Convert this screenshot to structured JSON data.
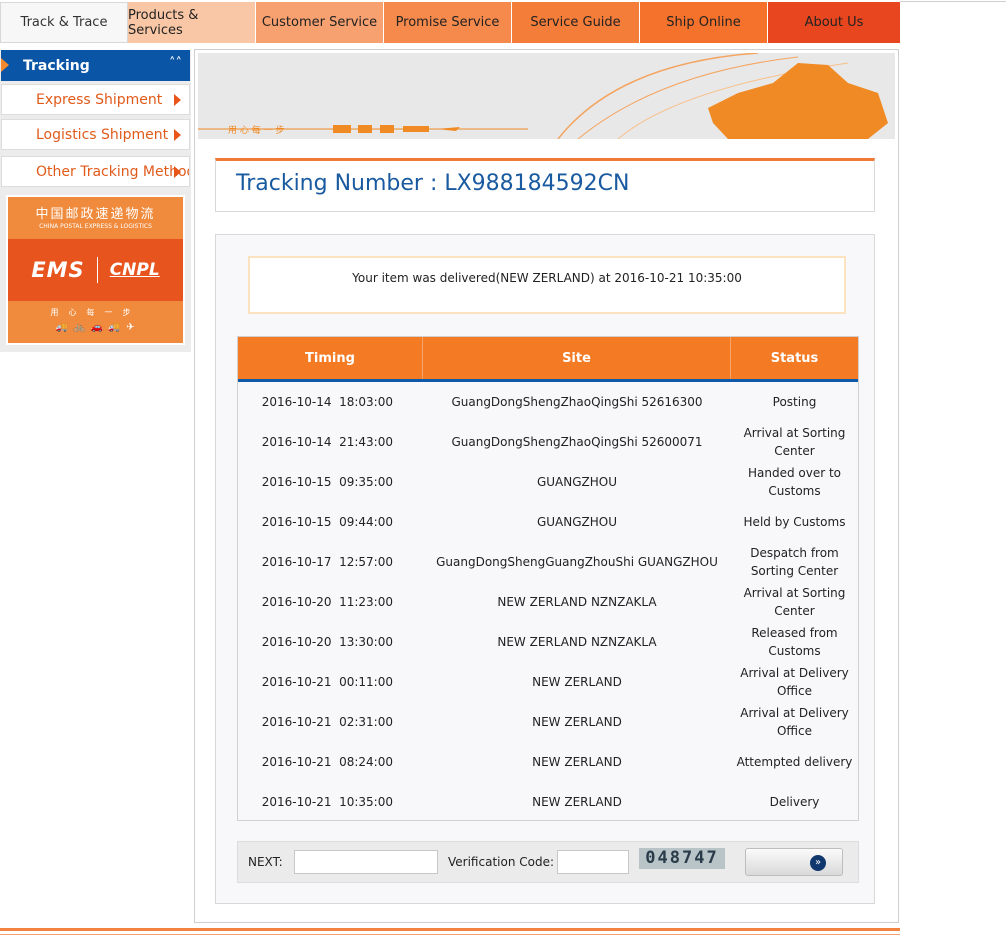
{
  "nav": {
    "items": [
      {
        "label": "Track & Trace"
      },
      {
        "label": "Products & Services"
      },
      {
        "label": "Customer Service"
      },
      {
        "label": "Promise Service"
      },
      {
        "label": "Service Guide"
      },
      {
        "label": "Ship Online"
      },
      {
        "label": "About Us"
      }
    ]
  },
  "sidebar": {
    "active": {
      "label": "Tracking",
      "icon": "double-chevron-up-icon"
    },
    "items": [
      {
        "label": "Express Shipment",
        "icon": "triangle-right-icon"
      },
      {
        "label": "Logistics Shipment",
        "icon": "triangle-right-icon"
      },
      {
        "label": "Other Tracking Methods",
        "icon": "triangle-right-icon"
      }
    ],
    "logo": {
      "cn_text": "中国邮政速递物流",
      "en_text": "CHINA POSTAL EXPRESS & LOGISTICS",
      "ems": "EMS",
      "cnpl": "CNPL",
      "slogan": "用心每一步"
    }
  },
  "main": {
    "title": "Tracking Number : LX988184592CN",
    "status_message": "Your item was delivered(NEW ZERLAND) at 2016-10-21 10:35:00",
    "table": {
      "headers": [
        "Timing",
        "Site",
        "Status"
      ],
      "rows": [
        {
          "timing": "2016-10-14  18:03:00",
          "site": "GuangDongShengZhaoQingShi 52616300",
          "status": "Posting"
        },
        {
          "timing": "2016-10-14  21:43:00",
          "site": "GuangDongShengZhaoQingShi 52600071",
          "status": "Arrival at Sorting Center"
        },
        {
          "timing": "2016-10-15  09:35:00",
          "site": "GUANGZHOU",
          "status": "Handed over to Customs"
        },
        {
          "timing": "2016-10-15  09:44:00",
          "site": "GUANGZHOU",
          "status": "Held by Customs"
        },
        {
          "timing": "2016-10-17  12:57:00",
          "site": "GuangDongShengGuangZhouShi GUANGZHOU",
          "status": "Despatch from Sorting Center"
        },
        {
          "timing": "2016-10-20  11:23:00",
          "site": "NEW ZERLAND NZNZAKLA",
          "status": "Arrival at Sorting Center"
        },
        {
          "timing": "2016-10-20  13:30:00",
          "site": "NEW ZERLAND NZNZAKLA",
          "status": "Released from Customs"
        },
        {
          "timing": "2016-10-21  00:11:00",
          "site": "NEW ZERLAND",
          "status": "Arrival at Delivery Office"
        },
        {
          "timing": "2016-10-21  02:31:00",
          "site": "NEW ZERLAND",
          "status": "Arrival at Delivery Office"
        },
        {
          "timing": "2016-10-21  08:24:00",
          "site": "NEW ZERLAND",
          "status": "Attempted delivery"
        },
        {
          "timing": "2016-10-21  10:35:00",
          "site": "NEW ZERLAND",
          "status": "Delivery"
        }
      ]
    },
    "next": {
      "label": "NEXT:",
      "value": "",
      "verification_label": "Verification Code:",
      "verification_value": "",
      "captcha": "048747",
      "go_icon": "double-chevron-right-icon"
    }
  },
  "colors": {
    "brand_orange": "#f47a24",
    "brand_blue": "#0b55a6",
    "title_blue": "#1a5aa0"
  }
}
